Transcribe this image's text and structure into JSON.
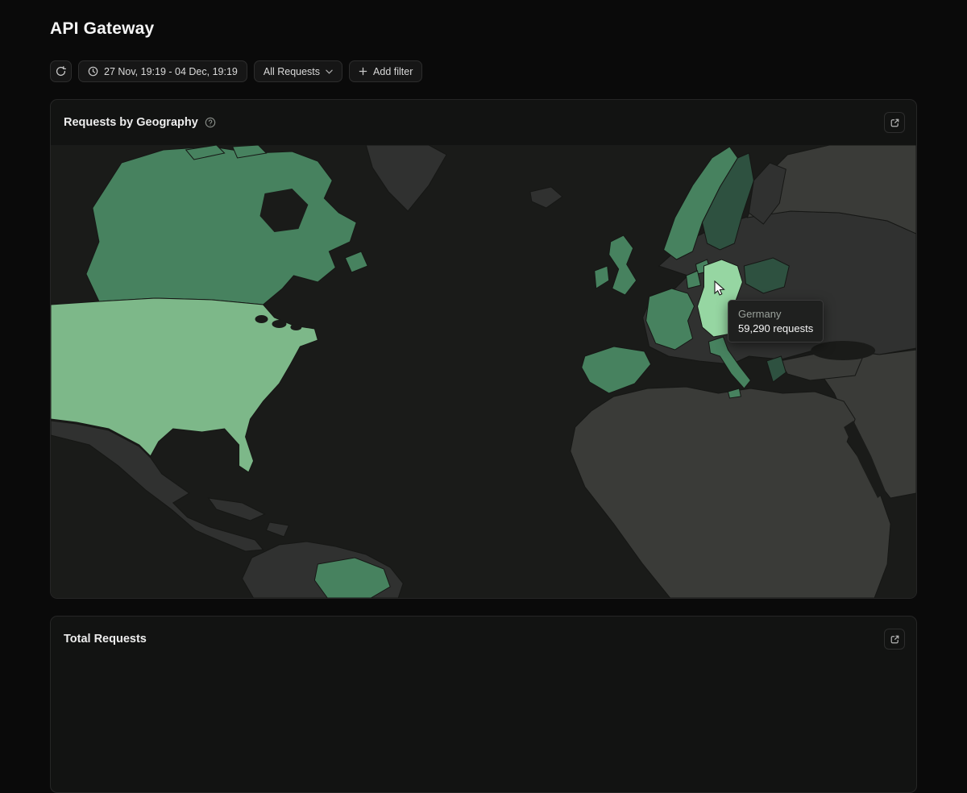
{
  "page": {
    "title": "API Gateway"
  },
  "toolbar": {
    "date_range": "27 Nov, 19:19 - 04 Dec, 19:19",
    "filter_selected": "All Requests",
    "add_filter_label": "Add filter"
  },
  "panels": {
    "geography": {
      "title": "Requests by Geography"
    },
    "total": {
      "title": "Total Requests"
    }
  },
  "tooltip": {
    "country": "Germany",
    "value": "59,290 requests"
  },
  "icons": [
    "refresh-icon",
    "clock-icon",
    "chevron-down-icon",
    "plus-icon",
    "help-icon",
    "external-link-icon",
    "mouse-cursor"
  ],
  "colors": {
    "page_bg": "#0a0a0a",
    "panel_bg": "#121312",
    "panel_border": "#262626",
    "ocean": "#1a1b19",
    "tooltip_bg": "#1f201f",
    "accent_green": "#7db889",
    "hover_green": "#96d6a2"
  },
  "map": {
    "ocean": "#1a1b19",
    "levels": {
      "none": "#303130",
      "muted": "#3a3b38",
      "low": "#2e5140",
      "medium": "#47825f",
      "high": "#63a375",
      "highest": "#7db889",
      "hover": "#96d6a2"
    },
    "countries": [
      {
        "id": "canada",
        "level": "medium"
      },
      {
        "id": "arctic-islands",
        "level": "medium"
      },
      {
        "id": "newfoundland",
        "level": "medium"
      },
      {
        "id": "united-states",
        "level": "highest"
      },
      {
        "id": "greenland",
        "level": "none"
      },
      {
        "id": "mexico",
        "level": "none"
      },
      {
        "id": "cuba",
        "level": "none"
      },
      {
        "id": "hispaniola",
        "level": "none"
      },
      {
        "id": "south-america",
        "level": "none"
      },
      {
        "id": "northern-south-america",
        "level": "medium"
      },
      {
        "id": "iceland",
        "level": "none"
      },
      {
        "id": "europe-other",
        "level": "none"
      },
      {
        "id": "russia",
        "level": "muted"
      },
      {
        "id": "middle-east",
        "level": "muted"
      },
      {
        "id": "turkey",
        "level": "muted"
      },
      {
        "id": "africa",
        "level": "muted"
      },
      {
        "id": "norway",
        "level": "medium"
      },
      {
        "id": "sweden",
        "level": "low"
      },
      {
        "id": "finland",
        "level": "none"
      },
      {
        "id": "denmark",
        "level": "medium"
      },
      {
        "id": "united-kingdom",
        "level": "medium"
      },
      {
        "id": "ireland",
        "level": "medium"
      },
      {
        "id": "benelux",
        "level": "medium"
      },
      {
        "id": "france",
        "level": "medium"
      },
      {
        "id": "spain-portugal",
        "level": "medium"
      },
      {
        "id": "italy",
        "level": "medium"
      },
      {
        "id": "sicily",
        "level": "medium"
      },
      {
        "id": "poland",
        "level": "low"
      },
      {
        "id": "greece",
        "level": "low"
      },
      {
        "id": "germany",
        "level": "hover"
      }
    ]
  }
}
